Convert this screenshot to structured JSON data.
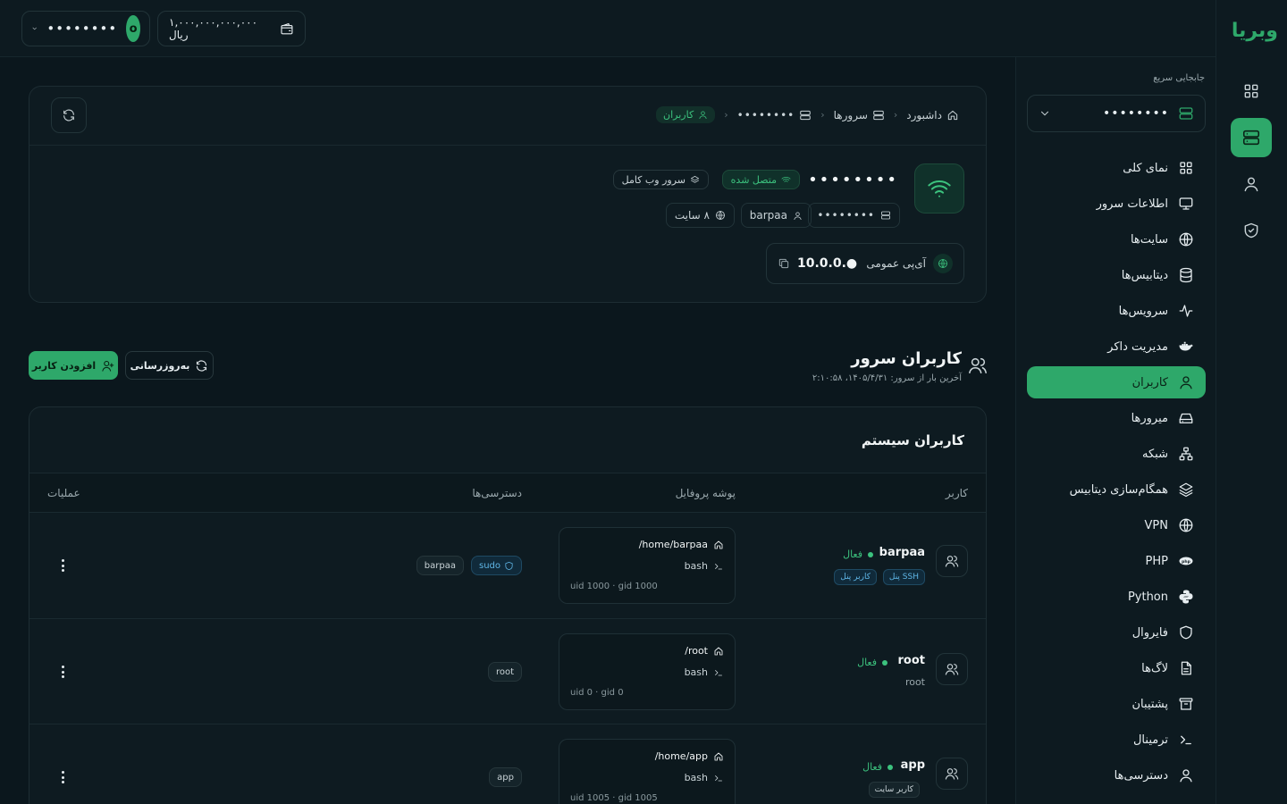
{
  "topbar": {
    "account_avatar": "o",
    "account_name": "••••••••",
    "wallet": "۱,۰۰۰,۰۰۰,۰۰۰,۰۰۰ ریال"
  },
  "logo": "وبریا",
  "sidebar": {
    "quick_label": "جابجایی سریع",
    "quick_value": "••••••••",
    "items": [
      {
        "label": "نمای کلی",
        "icon": "grid-icon"
      },
      {
        "label": "اطلاعات سرور",
        "icon": "monitor-icon"
      },
      {
        "label": "سایت‌ها",
        "icon": "globe-icon"
      },
      {
        "label": "دیتابیس‌ها",
        "icon": "database-icon"
      },
      {
        "label": "سرویس‌ها",
        "icon": "activity-icon"
      },
      {
        "label": "مدیریت داکر",
        "icon": "docker-icon"
      },
      {
        "label": "کاربران",
        "icon": "user-icon"
      },
      {
        "label": "میرورها",
        "icon": "hard-drive-icon"
      },
      {
        "label": "شبکه",
        "icon": "network-icon"
      },
      {
        "label": "همگام‌سازی دیتابیس",
        "icon": "layers-icon"
      },
      {
        "label": "VPN",
        "icon": "globe-lock-icon"
      },
      {
        "label": "PHP",
        "icon": "php-icon"
      },
      {
        "label": "Python",
        "icon": "python-icon"
      },
      {
        "label": "فایروال",
        "icon": "shield-icon"
      },
      {
        "label": "لاگ‌ها",
        "icon": "file-text-icon"
      },
      {
        "label": "پشتیبان",
        "icon": "archive-icon"
      },
      {
        "label": "ترمینال",
        "icon": "terminal-icon"
      },
      {
        "label": "دسترسی‌ها",
        "icon": "user-key-icon"
      }
    ]
  },
  "breadcrumb": {
    "dashboard": "داشبورد",
    "servers": "سرورها",
    "server": "••••••••",
    "current": "کاربران"
  },
  "server": {
    "name": "••••••••",
    "status": "متصل شده",
    "type": "سرور وب کامل",
    "host": "••••••••",
    "user": "barpaa",
    "sites": "۸ سایت",
    "ip_label": "آی‌پی عمومی",
    "ip": "10.0.0.●"
  },
  "section": {
    "title": "کاربران سرور",
    "subtitle": "آخرین بار از سرور: ۱۴۰۵/۴/۳۱، ۲:۱۰:۵۸",
    "add_button": "افزودن کاربر",
    "refresh_button": "به‌روزرسانی"
  },
  "users_table": {
    "title": "کاربران سیستم",
    "columns": [
      "کاربر",
      "پوشه پروفایل",
      "دسترسی‌ها",
      "عملیات"
    ],
    "rows": [
      {
        "name": "barpaa",
        "status": "فعال",
        "tags": [
          "SSH پنل",
          "کاربر پنل"
        ],
        "home": "/home/barpaa",
        "shell": "bash",
        "uid": "uid 1000 · gid 1000",
        "perms": [
          "sudo",
          "barpaa"
        ]
      },
      {
        "name": "root",
        "status": "فعال",
        "sub": "root",
        "home": "/root",
        "shell": "bash",
        "uid": "uid 0 · gid 0",
        "perms": [
          "root"
        ]
      },
      {
        "name": "app",
        "status": "فعال",
        "tags": [
          "کاربر سایت"
        ],
        "home": "/home/app",
        "shell": "bash",
        "uid": "uid 1005 · gid 1005",
        "perms": [
          "app"
        ]
      }
    ]
  },
  "colors": {
    "accent": "#2ea86a",
    "background": "#0b171d",
    "card": "#0e1b21",
    "info": "#5fb6e6"
  }
}
